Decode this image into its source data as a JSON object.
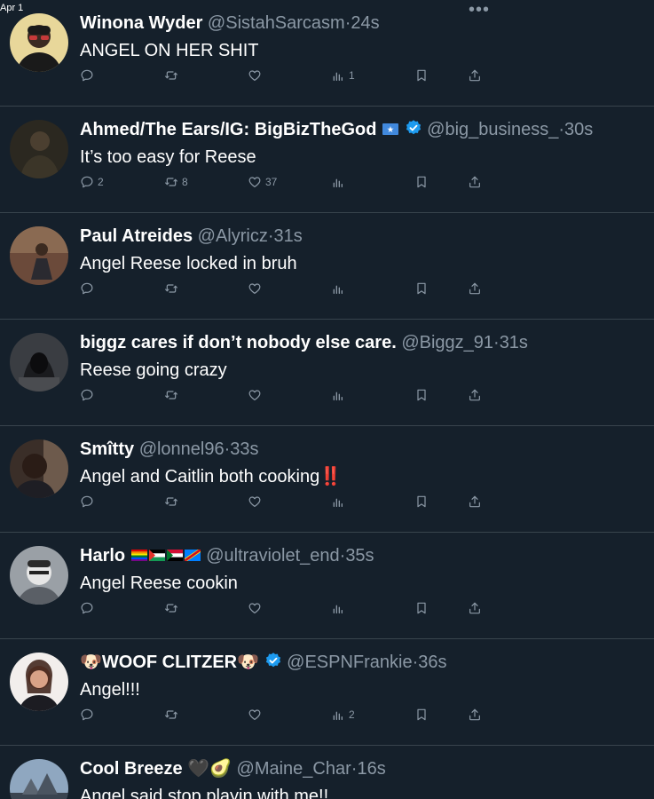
{
  "page": {
    "date_label": "Apr 1",
    "more_icon": "more-horizontal-icon"
  },
  "colors": {
    "background": "#15202b",
    "muted": "#8b98a5",
    "divider": "#38444d",
    "verified": "#1d9bf0",
    "red": "#f4212e"
  },
  "tweets": [
    {
      "name": "Winona Wyder",
      "handle": "@SistahSarcasm",
      "dot": "·",
      "time": "24s",
      "text": "ANGEL ON HER SHIT",
      "replies": "",
      "retweets": "",
      "likes": "",
      "views": "1"
    },
    {
      "name": "Ahmed/The Ears/IG: BigBizTheGod",
      "handle": "@big_business_",
      "dot": "·",
      "time": "30s",
      "text": "It’s too easy for Reese",
      "replies": "2",
      "retweets": "8",
      "likes": "37",
      "views": ""
    },
    {
      "name": "Paul Atreides",
      "handle": "@Alyricz",
      "dot": "·",
      "time": "31s",
      "text": "Angel Reese locked in bruh",
      "replies": "",
      "retweets": "",
      "likes": "",
      "views": ""
    },
    {
      "name": "biggz cares if don’t nobody else care.",
      "handle": "@Biggz_91",
      "dot": "·",
      "time": "31s",
      "text": "Reese going crazy",
      "replies": "",
      "retweets": "",
      "likes": "",
      "views": ""
    },
    {
      "name": "Smîtty",
      "handle": "@lonnel96",
      "dot": "·",
      "time": "33s",
      "text": "Angel and Caitlin both cooking",
      "emoji": "‼️",
      "replies": "",
      "retweets": "",
      "likes": "",
      "views": ""
    },
    {
      "name": "Harlo",
      "handle": "@ultraviolet_end",
      "dot": "·",
      "time": "35s",
      "text": "Angel Reese cookin",
      "replies": "",
      "retweets": "",
      "likes": "",
      "views": ""
    },
    {
      "name": "WOOF CLITZER",
      "name_emoji": "🐶",
      "handle": "@ESPNFrankie",
      "dot": "·",
      "time": "36s",
      "text": "Angel!!!",
      "replies": "",
      "retweets": "",
      "likes": "",
      "views": "2"
    },
    {
      "name": "Cool Breeze",
      "name_emoji_1": "🖤",
      "name_emoji_2": "🥑",
      "handle": "@Maine_Char",
      "dot": "·",
      "time": "16s",
      "text": "Angel said stop playin with me!!"
    }
  ],
  "icons": {
    "reply": "reply-icon",
    "retweet": "retweet-icon",
    "like": "heart-icon",
    "views": "views-icon",
    "bookmark": "bookmark-icon",
    "share": "share-icon",
    "verified": "verified-badge-icon"
  }
}
